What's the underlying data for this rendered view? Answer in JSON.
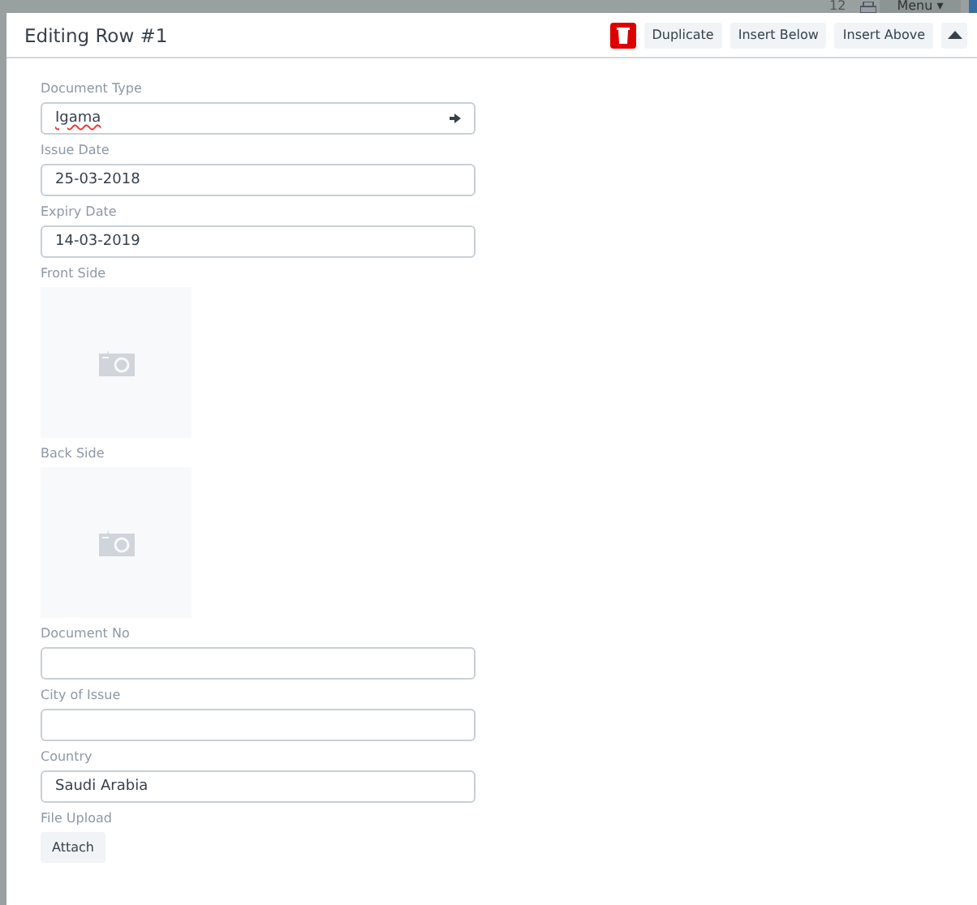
{
  "background_bar": {
    "count": "12",
    "menu": "Menu ▾"
  },
  "dialog": {
    "title": "Editing Row #1",
    "actions": [
      "Duplicate",
      "Insert Below",
      "Insert Above"
    ]
  },
  "fields": [
    {
      "kind": "link",
      "label": "Document Type",
      "value": "Igama"
    },
    {
      "kind": "input",
      "label": "Issue Date",
      "value": "25-03-2018"
    },
    {
      "kind": "input",
      "label": "Expiry Date",
      "value": "14-03-2019"
    },
    {
      "kind": "image",
      "label": "Front Side"
    },
    {
      "kind": "image",
      "label": "Back Side"
    },
    {
      "kind": "input",
      "label": "Document No"
    },
    {
      "kind": "input",
      "label": "City of Issue"
    },
    {
      "kind": "input",
      "label": "Country",
      "value": "Saudi Arabia"
    },
    {
      "kind": "upload",
      "label": "File Upload",
      "button": "Attach"
    }
  ]
}
